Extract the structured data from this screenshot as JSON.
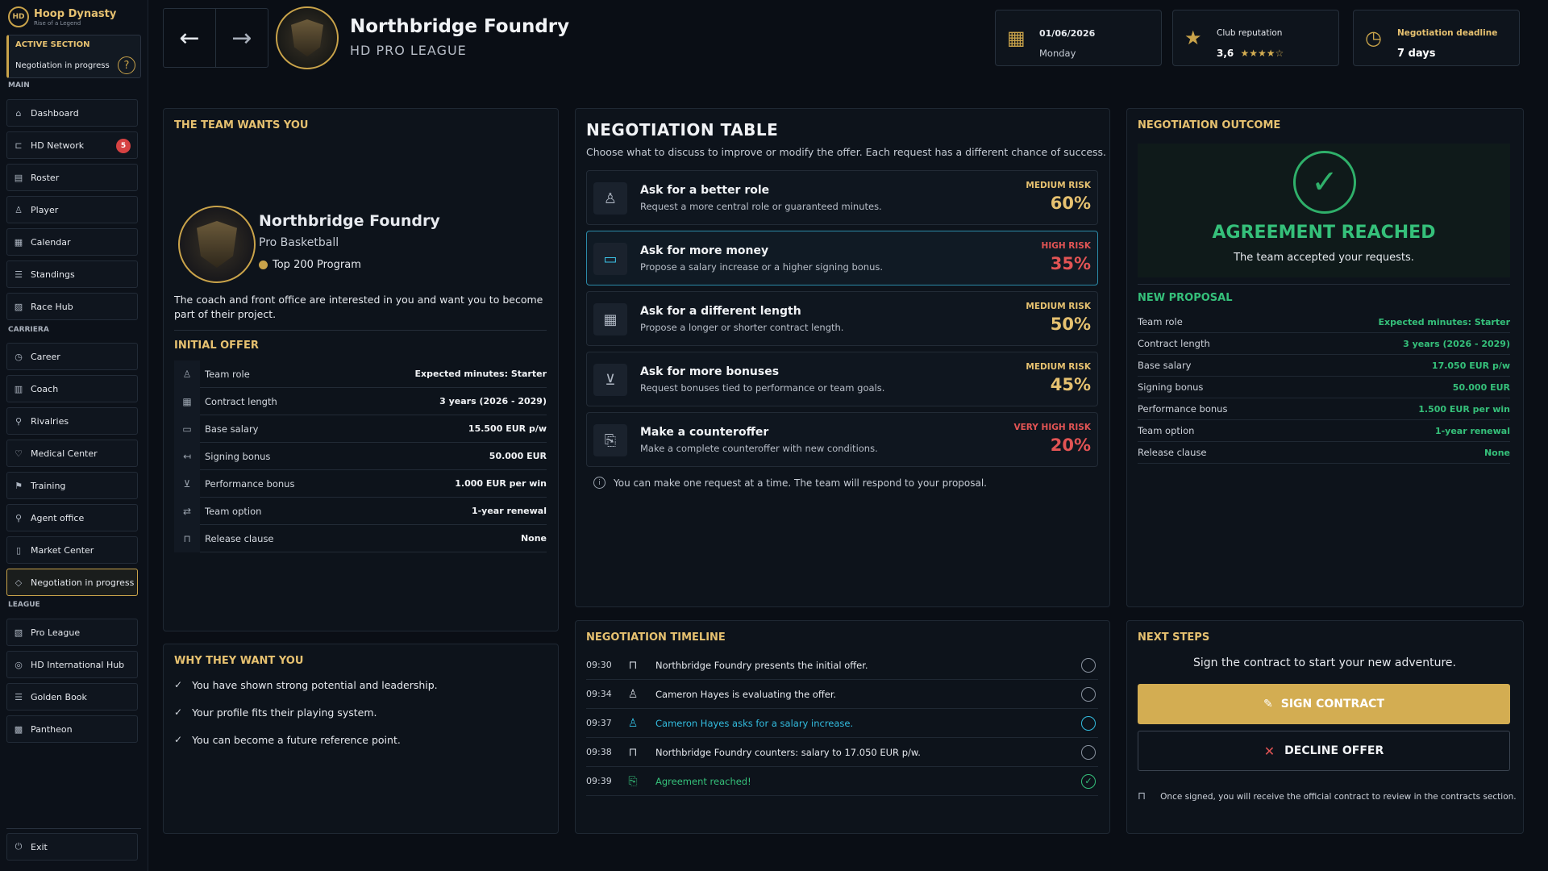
{
  "brand": {
    "initials": "HD",
    "title": "Hoop Dynasty",
    "subtitle": "Rise of a Legend"
  },
  "active_section": {
    "title": "ACTIVE SECTION",
    "value": "Negotiation in progress"
  },
  "sidebar": {
    "groups": {
      "main": "MAIN",
      "career": "CARRIERA",
      "league": "LEAGUE"
    },
    "items": [
      {
        "label": "Dashboard",
        "icon": "⌂"
      },
      {
        "label": "HD Network",
        "icon": "⊏",
        "badge": "5"
      },
      {
        "label": "Roster",
        "icon": "▤"
      },
      {
        "label": "Player",
        "icon": "♙"
      },
      {
        "label": "Calendar",
        "icon": "▦"
      },
      {
        "label": "Standings",
        "icon": "☰"
      },
      {
        "label": "Race Hub",
        "icon": "▨"
      },
      {
        "label": "Career",
        "icon": "◷"
      },
      {
        "label": "Coach",
        "icon": "▥"
      },
      {
        "label": "Rivalries",
        "icon": "⚲"
      },
      {
        "label": "Medical Center",
        "icon": "♡"
      },
      {
        "label": "Training",
        "icon": "⚑"
      },
      {
        "label": "Agent office",
        "icon": "⚲"
      },
      {
        "label": "Market Center",
        "icon": "▯"
      },
      {
        "label": "Negotiation in progress",
        "icon": "◇"
      },
      {
        "label": "Pro League",
        "icon": "▧"
      },
      {
        "label": "HD International Hub",
        "icon": "◎"
      },
      {
        "label": "Golden Book",
        "icon": "☰"
      },
      {
        "label": "Pantheon",
        "icon": "▩"
      }
    ],
    "exit": {
      "label": "Exit",
      "icon": "⏻"
    }
  },
  "header": {
    "club": "Northbridge Foundry",
    "league": "HD PRO LEAGUE",
    "date": {
      "value": "01/06/2026",
      "day": "Monday"
    },
    "reputation": {
      "label": "Club reputation",
      "value": "3,6",
      "stars": "★★★★☆"
    },
    "deadline": {
      "label": "Negotiation deadline",
      "value": "7 days"
    }
  },
  "team_panel": {
    "title": "THE TEAM WANTS YOU",
    "name": "Northbridge Foundry",
    "sport": "Pro Basketball",
    "program": "Top 200 Program",
    "description": "The coach and front office are interested in you and want you to become part of their project.",
    "offer_title": "INITIAL OFFER",
    "offer": [
      {
        "label": "Team role",
        "value": "Expected minutes: Starter",
        "icon": "♙"
      },
      {
        "label": "Contract length",
        "value": "3 years (2026 - 2029)",
        "icon": "▦"
      },
      {
        "label": "Base salary",
        "value": "15.500 EUR p/w",
        "icon": "▭"
      },
      {
        "label": "Signing bonus",
        "value": "50.000 EUR",
        "icon": "↤"
      },
      {
        "label": "Performance bonus",
        "value": "1.000 EUR per win",
        "icon": "⊻"
      },
      {
        "label": "Team option",
        "value": "1-year renewal",
        "icon": "⇄"
      },
      {
        "label": "Release clause",
        "value": "None",
        "icon": "⊓"
      }
    ]
  },
  "why_panel": {
    "title": "WHY THEY WANT YOU",
    "items": [
      "You have shown strong potential and leadership.",
      "Your profile fits their playing system.",
      "You can become a future reference point."
    ]
  },
  "negotiation": {
    "title": "NEGOTIATION TABLE",
    "subtitle": "Choose what to discuss to improve or modify the offer. Each request has a different chance of success.",
    "requests": [
      {
        "title": "Ask for a better role",
        "desc": "Request a more central role or guaranteed minutes.",
        "risk": "MEDIUM RISK",
        "pct": "60%",
        "icon": "♙",
        "risk_color": "#e6c170"
      },
      {
        "title": "Ask for more money",
        "desc": "Propose a salary increase or a higher signing bonus.",
        "risk": "HIGH RISK",
        "pct": "35%",
        "icon": "▭",
        "risk_color": "#e25454"
      },
      {
        "title": "Ask for a different length",
        "desc": "Propose a longer or shorter contract length.",
        "risk": "MEDIUM RISK",
        "pct": "50%",
        "icon": "▦",
        "risk_color": "#e6c170"
      },
      {
        "title": "Ask for more bonuses",
        "desc": "Request bonuses tied to performance or team goals.",
        "risk": "MEDIUM RISK",
        "pct": "45%",
        "icon": "⊻",
        "risk_color": "#e6c170"
      },
      {
        "title": "Make a counteroffer",
        "desc": "Make a complete counteroffer with new conditions.",
        "risk": "VERY HIGH RISK",
        "pct": "20%",
        "icon": "⎘",
        "risk_color": "#e25454"
      }
    ],
    "note": "You can make one request at a time. The team will respond to your proposal."
  },
  "outcome": {
    "title": "NEGOTIATION OUTCOME",
    "status": "AGREEMENT REACHED",
    "status_sub": "The team accepted your requests.",
    "proposal_title": "NEW PROPOSAL",
    "proposal": [
      {
        "label": "Team role",
        "value": "Expected minutes: Starter"
      },
      {
        "label": "Contract length",
        "value": "3 years (2026 - 2029)"
      },
      {
        "label": "Base salary",
        "value": "17.050 EUR p/w"
      },
      {
        "label": "Signing bonus",
        "value": "50.000 EUR"
      },
      {
        "label": "Performance bonus",
        "value": "1.500 EUR per win"
      },
      {
        "label": "Team option",
        "value": "1-year renewal"
      },
      {
        "label": "Release clause",
        "value": "None"
      }
    ]
  },
  "timeline": {
    "title": "NEGOTIATION TIMELINE",
    "events": [
      {
        "time": "09:30",
        "text": "Northbridge Foundry presents the initial offer.",
        "icon": "⊓",
        "style": ""
      },
      {
        "time": "09:34",
        "text": "Cameron Hayes is evaluating the offer.",
        "icon": "♙",
        "style": ""
      },
      {
        "time": "09:37",
        "text": "Cameron Hayes asks for a salary increase.",
        "icon": "♙",
        "style": "cyan"
      },
      {
        "time": "09:38",
        "text": "Northbridge Foundry counters: salary to 17.050 EUR p/w.",
        "icon": "⊓",
        "style": ""
      },
      {
        "time": "09:39",
        "text": "Agreement reached!",
        "icon": "⎘",
        "style": "green"
      }
    ]
  },
  "next_steps": {
    "title": "NEXT STEPS",
    "subtitle": "Sign the contract to start your new adventure.",
    "sign": "SIGN CONTRACT",
    "decline": "DECLINE OFFER",
    "note": "Once signed, you will receive the official contract to review in the contracts section."
  }
}
